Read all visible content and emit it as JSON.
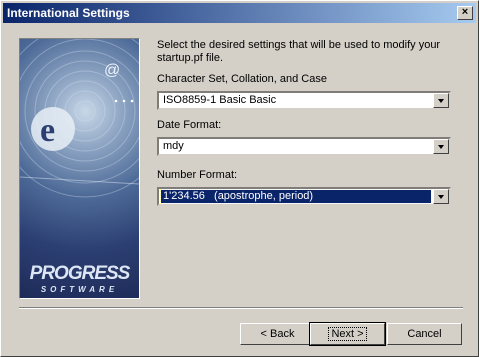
{
  "window": {
    "title": "International Settings",
    "close_glyph": "×"
  },
  "branding": {
    "logo_main": "PROGRESS",
    "logo_sub": "SOFTWARE",
    "icon": "e-at-logo-artwork"
  },
  "description": "Select the desired settings that will be used to modify your startup.pf file.",
  "fields": {
    "charset": {
      "label": "Character Set, Collation, and Case",
      "value": "ISO8859-1 Basic Basic"
    },
    "date_format": {
      "label": "Date Format:",
      "value": "mdy"
    },
    "number_format": {
      "label": "Number Format:",
      "value": "1'234.56   (apostrophe, period)"
    }
  },
  "buttons": {
    "back": "< Back",
    "next": "Next >",
    "cancel": "Cancel"
  }
}
